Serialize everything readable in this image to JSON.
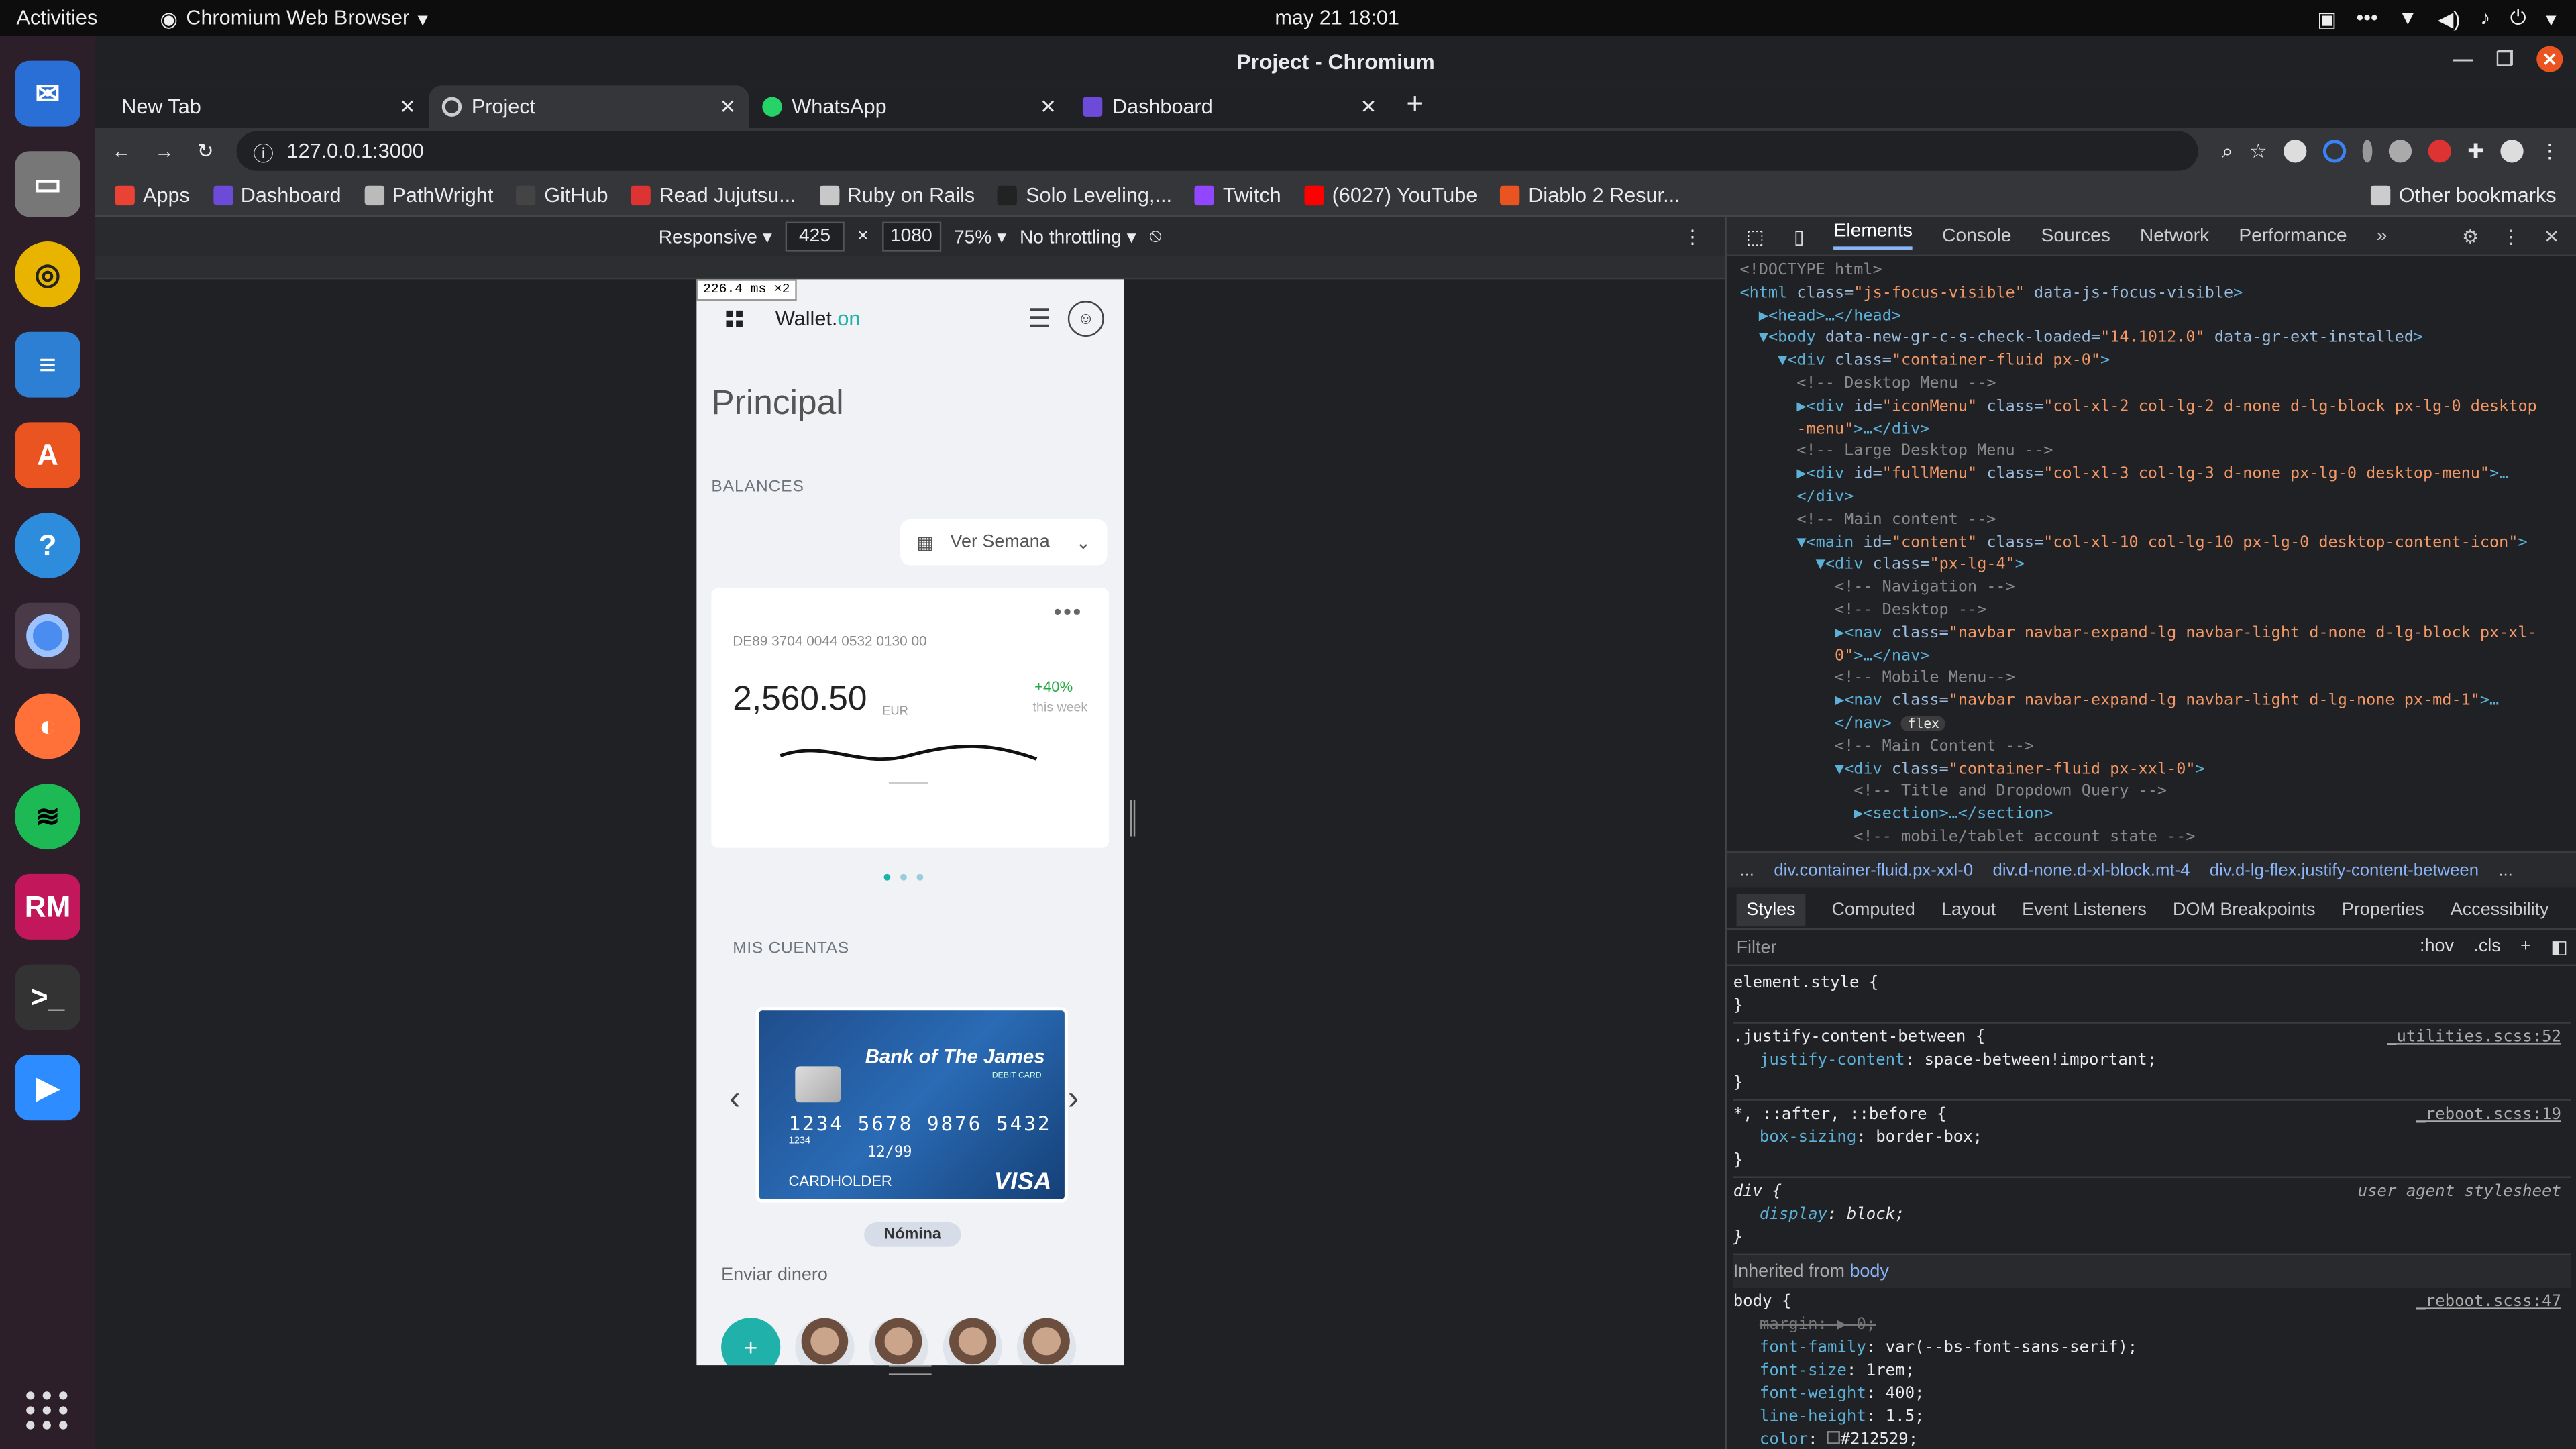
{
  "topbar": {
    "activities": "Activities",
    "app": "Chromium Web Browser",
    "clock": "may 21  18:01"
  },
  "window": {
    "title": "Project - Chromium",
    "tabs": [
      {
        "label": "New Tab",
        "color": "#888888"
      },
      {
        "label": "Project",
        "color": "#cccccc"
      },
      {
        "label": "WhatsApp",
        "color": "#25d366"
      },
      {
        "label": "Dashboard",
        "color": "#6c4bd8"
      }
    ],
    "url": "127.0.0.1:3000",
    "bookmarks": [
      {
        "label": "Apps",
        "color": "#ea4335"
      },
      {
        "label": "Dashboard",
        "color": "#6c4bd8"
      },
      {
        "label": "PathWright",
        "color": "#bbbbbb"
      },
      {
        "label": "GitHub",
        "color": "#444444"
      },
      {
        "label": "Read Jujutsu...",
        "color": "#d33"
      },
      {
        "label": "Ruby on Rails",
        "color": "#c8c8c8"
      },
      {
        "label": "Solo Leveling,...",
        "color": "#222222"
      },
      {
        "label": "Twitch",
        "color": "#9146ff"
      },
      {
        "label": "(6027) YouTube",
        "color": "#ff0000"
      },
      {
        "label": "Diablo 2 Resur...",
        "color": "#e95420"
      }
    ],
    "other_bookmarks": "Other bookmarks"
  },
  "device_toolbar": {
    "mode": "Responsive",
    "width": "425",
    "height": "1080",
    "zoom": "75%",
    "throttle": "No throttling"
  },
  "phone": {
    "fps": "226.4 ms ×2",
    "brand": "Wallet.",
    "brand_accent": "on",
    "title": "Principal",
    "balances": "BALANCES",
    "select": "Ver Semana",
    "iban": "DE89 3704 0044 0532 0130 00",
    "amount": "2,560.50",
    "currency": "EUR",
    "change": "+40%",
    "period": "this week",
    "mis_cuentas": "MIS CUENTAS",
    "card": {
      "bank": "Bank of The James",
      "type": "DEBIT CARD",
      "number": "1234  5678  9876  5432",
      "small": "1234",
      "valid": "12/99",
      "holder": "CARDHOLDER",
      "brand": "VISA"
    },
    "account_tag": "Nómina",
    "send": "Enviar dinero"
  },
  "devtools": {
    "tabs": [
      "Elements",
      "Console",
      "Sources",
      "Network",
      "Performance"
    ],
    "breadcrumbs": [
      "...",
      "div.container-fluid.px-xxl-0",
      "div.d-none.d-xl-block.mt-4",
      "div.d-lg-flex.justify-content-between",
      "..."
    ],
    "style_tabs": [
      "Styles",
      "Computed",
      "Layout",
      "Event Listeners",
      "DOM Breakpoints",
      "Properties",
      "Accessibility"
    ],
    "filter": "Filter",
    "hov": ":hov",
    "cls": ".cls",
    "element_style": "element.style {",
    "rules": [
      {
        "selector": ".justify-content-between {",
        "source": "_utilities.scss:52",
        "prop": "justify-content",
        "value": "space-between!important;"
      },
      {
        "selector": "*, ::after, ::before {",
        "source": "_reboot.scss:19",
        "prop": "box-sizing",
        "value": "border-box;"
      },
      {
        "selector": "div {",
        "source": "user agent stylesheet",
        "prop": "display",
        "value": "block;"
      }
    ],
    "inherited_label": "Inherited from",
    "inherited_from": "body",
    "body_rule": {
      "selector": "body {",
      "source": "_reboot.scss:47",
      "props": [
        {
          "name": "margin",
          "value": "0;"
        },
        {
          "name": "font-family",
          "value": "var(--bs-font-sans-serif);"
        },
        {
          "name": "font-size",
          "value": "1rem;"
        },
        {
          "name": "font-weight",
          "value": "400;"
        },
        {
          "name": "line-height",
          "value": "1.5;"
        },
        {
          "name": "color",
          "value": "#212529;"
        }
      ]
    }
  }
}
